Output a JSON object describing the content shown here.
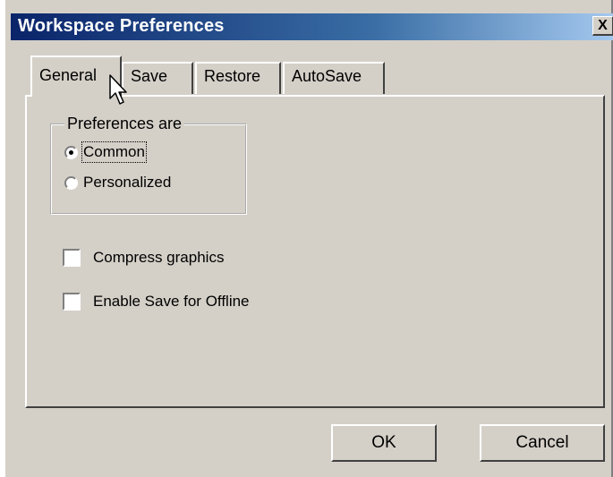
{
  "window": {
    "title": "Workspace Preferences",
    "close_label": "X"
  },
  "tabs": [
    {
      "label": "General",
      "active": true
    },
    {
      "label": "Save",
      "active": false
    },
    {
      "label": "Restore",
      "active": false
    },
    {
      "label": "AutoSave",
      "active": false
    }
  ],
  "general": {
    "group_label": "Preferences are",
    "radios": [
      {
        "label": "Common",
        "selected": true
      },
      {
        "label": "Personalized",
        "selected": false
      }
    ],
    "checkboxes": [
      {
        "label": "Compress graphics",
        "checked": false
      },
      {
        "label": "Enable Save for Offline",
        "checked": false
      }
    ]
  },
  "buttons": {
    "ok": "OK",
    "cancel": "Cancel"
  },
  "cursor": {
    "icon": "arrow-pointer-icon"
  }
}
